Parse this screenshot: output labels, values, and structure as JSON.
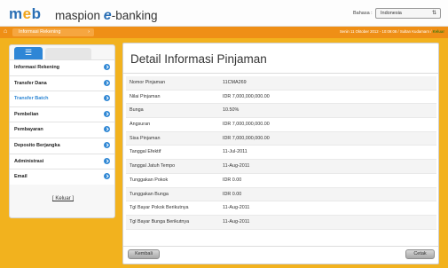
{
  "header": {
    "logo_part1": "m",
    "logo_part2": "e",
    "logo_part3": "b",
    "brand_text": "maspion",
    "brand_e": "e",
    "brand_suffix": "-banking",
    "language_label": "Bahasa :",
    "language_value": "Indonesia"
  },
  "navbar": {
    "home_icon": "home-icon",
    "active_tab": "Informasi Rekening",
    "info_text": "Senin 11 Oktober 2012 - 10:09:08 / Sultan Kudamarn",
    "logout_label": "Keluar"
  },
  "sidebar": {
    "items": [
      {
        "label": "Informasi Rekening",
        "active": false
      },
      {
        "label": "Transfer Dana",
        "active": false
      },
      {
        "label": "Transfer Batch",
        "active": true
      },
      {
        "label": "Pembelian",
        "active": false
      },
      {
        "label": "Pembayaran",
        "active": false
      },
      {
        "label": "Deposito Berjangka",
        "active": false
      },
      {
        "label": "Administrasi",
        "active": false
      },
      {
        "label": "Email",
        "active": false
      }
    ],
    "logout_link": "[ Keluar ]"
  },
  "main": {
    "title": "Detail Informasi Pinjaman",
    "rows": [
      {
        "label": "Nomor Pinjaman",
        "value": "11CMA269"
      },
      {
        "label": "Nilai Pinjaman",
        "value": "IDR 7,000,000,000.00"
      },
      {
        "label": "Bunga",
        "value": "10.50%"
      },
      {
        "label": "Angsuran",
        "value": "IDR 7,000,000,000.00"
      },
      {
        "label": "Sisa Pinjaman",
        "value": "IDR 7,000,000,000.00"
      },
      {
        "label": "Tanggal Efektif",
        "value": "11-Jul-2011"
      },
      {
        "label": "Tanggal Jatuh Tempo",
        "value": "11-Aug-2011"
      },
      {
        "label": "Tunggakan Pokok",
        "value": "IDR 0.00"
      },
      {
        "label": "Tunggakan Bunga",
        "value": "IDR 0.00"
      },
      {
        "label": "Tgl Bayar Pokok Berikutnya",
        "value": "11-Aug-2011"
      },
      {
        "label": "Tgl Bayar Bunga Berikutnya",
        "value": "11-Aug-2011"
      }
    ],
    "back_button": "Kembali",
    "print_button": "Cetak"
  }
}
